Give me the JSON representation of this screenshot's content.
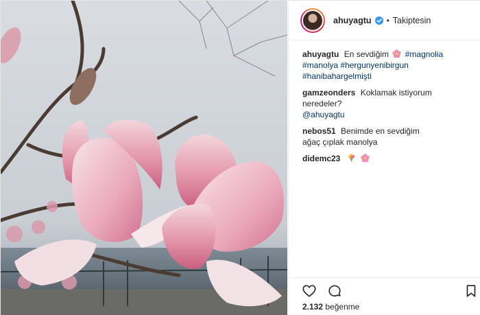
{
  "post": {
    "author": {
      "username": "ahuyagtu",
      "verified": true,
      "follow_status": "Takiptesin",
      "separator": "•"
    },
    "caption": {
      "username": "ahuyagtu",
      "text": "En sevdiğim",
      "emoji": "cherry-blossom",
      "hashtags": [
        "#magnolia",
        "#manolya",
        "#hergunyenibirgun",
        "#hanibahargelmişti"
      ]
    },
    "comments": [
      {
        "username": "gamzeonders",
        "text": "Koklamak istiyorum neredeler?",
        "mention": "@ahuyagtu"
      },
      {
        "username": "nebos51",
        "text": "Benimde en sevdiğim ağaç çıplak manolya"
      },
      {
        "username": "didemc23",
        "text": "",
        "emojis": [
          "bouquet",
          "cherry-blossom"
        ]
      }
    ],
    "likes": {
      "count": "2.132",
      "label": "beğenme"
    },
    "icons": {
      "like": "heart-icon",
      "comment": "comment-icon",
      "save": "bookmark-icon"
    },
    "colors": {
      "hashtag": "#003569",
      "text": "#262626",
      "verified": "#3897f0"
    }
  }
}
